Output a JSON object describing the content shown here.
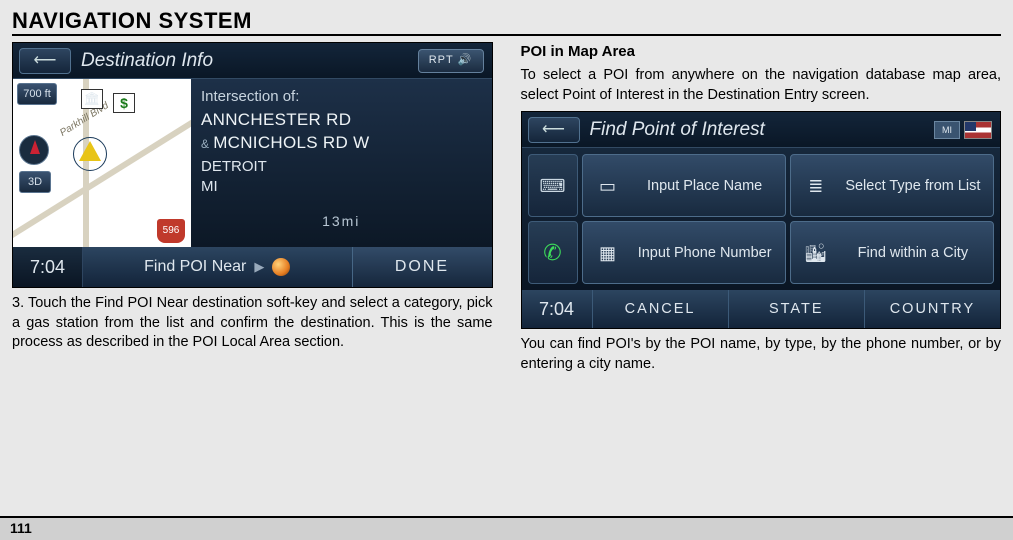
{
  "page": {
    "title": "NAVIGATION SYSTEM",
    "number": "111"
  },
  "left": {
    "screenshot": {
      "back_glyph": "⟵",
      "title": "Destination Info",
      "rpt_label": "RPT 🔊",
      "map": {
        "alt": "700 ft",
        "threeD": "3D",
        "road_label": "Parkhill Blvd",
        "bank_glyph": "🏛",
        "gas_glyph": "$",
        "shield": "596"
      },
      "info": {
        "header": "Intersection of:",
        "road1": "ANNCHESTER RD",
        "amp": "&",
        "road2": "MCNICHOLS RD W",
        "city": "DETROIT",
        "state": "MI",
        "dist": "13mi"
      },
      "time": "7:04",
      "findpoi": "Find POI Near",
      "findpoi_arrow": "▶",
      "done": "DONE"
    },
    "para3": "3. Touch the Find POI Near destination soft-key and select a category, pick a gas station from the list and confirm the destination. This is the same process as described in the POI Local Area section."
  },
  "right": {
    "subhead": "POI in Map Area",
    "intro": "To select a POI from anywhere on the navigation database map area, select Point of Interest in the Destination Entry screen.",
    "screenshot": {
      "back_glyph": "⟵",
      "title": "Find Point of Interest",
      "state_chip": "MI",
      "kb_glyph": "⌨",
      "phone_glyph": "✆",
      "opts": {
        "input_place": "Input Place Name",
        "select_type": "Select Type from List",
        "input_phone": "Input Phone Number",
        "find_city": "Find within a City"
      },
      "time": "7:04",
      "cancel": "CANCEL",
      "state": "STATE",
      "country": "COUNTRY"
    },
    "outro": "You can find POI's by the POI name, by type, by the phone number, or by entering a city name."
  }
}
